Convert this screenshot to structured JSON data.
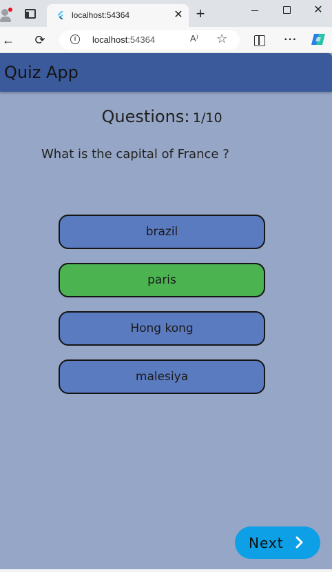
{
  "browser": {
    "tab": {
      "title": "localhost:54364",
      "close": "✕"
    },
    "newtab": "+",
    "window": {
      "minimize": "",
      "maximize": "",
      "close": "✕"
    },
    "nav": {
      "back": "←",
      "reload": "⟳",
      "more": "···"
    },
    "address": {
      "host": "localhost",
      "port": ":54364",
      "read_aloud": "A⁾",
      "favorite": "☆"
    }
  },
  "app": {
    "title": "Quiz App",
    "counter_label": "Questions:",
    "counter_value": "1/10",
    "question": "What is the capital of France ?",
    "options": [
      {
        "label": "brazil",
        "state": "default"
      },
      {
        "label": "paris",
        "state": "correct"
      },
      {
        "label": "Hong kong",
        "state": "default"
      },
      {
        "label": "malesiya",
        "state": "default"
      }
    ],
    "next_label": "Next"
  },
  "colors": {
    "appbar": "#3a5a9b",
    "page_bg": "#96a6c6",
    "option_default": "#5b7bc0",
    "option_correct": "#4bb450",
    "next_button": "#0ea0e6"
  }
}
